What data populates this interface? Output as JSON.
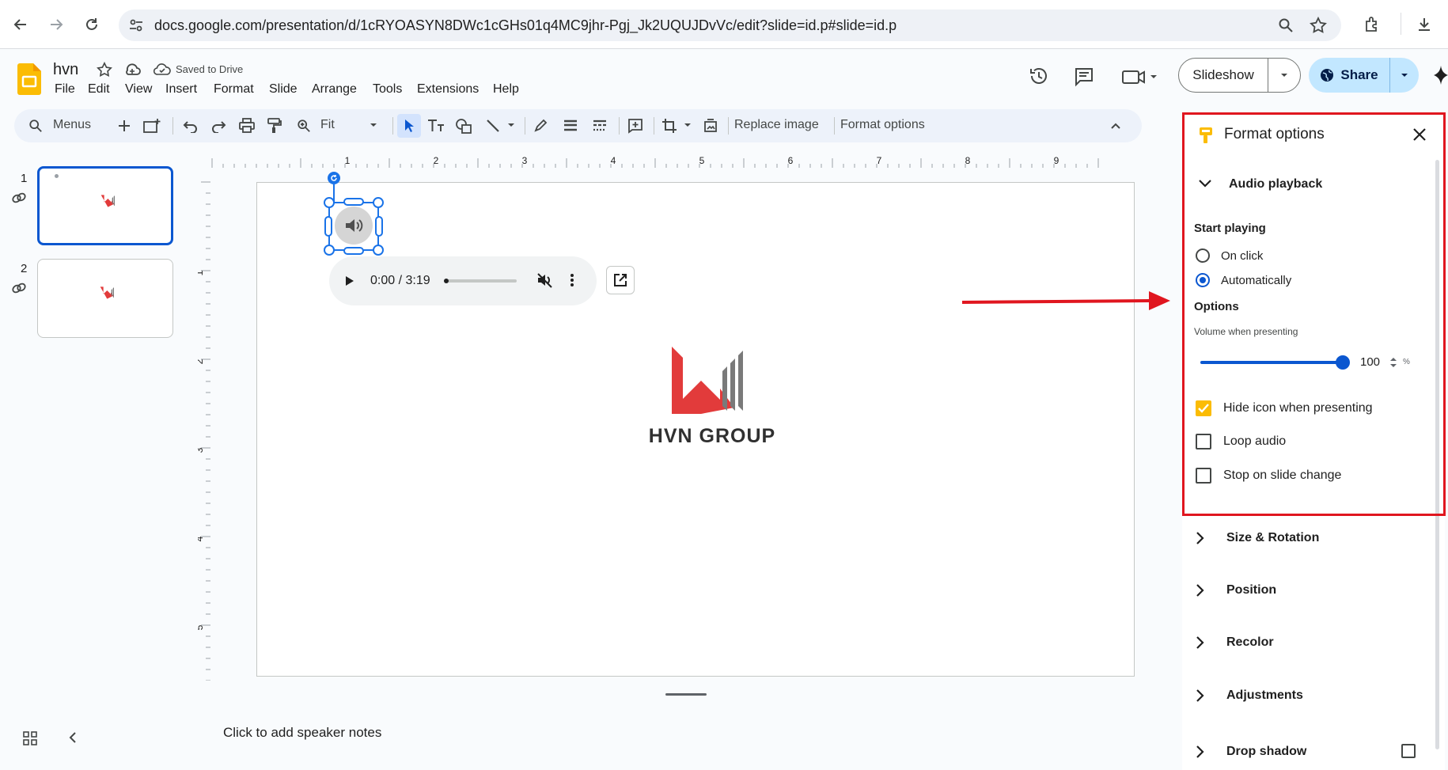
{
  "browser": {
    "url": "docs.google.com/presentation/d/1cRYOASYN8DWc1cGHs01q4MC9jhr-Pgj_Jk2UQUJDvVc/edit?slide=id.p#slide=id.p"
  },
  "app": {
    "doc_title": "hvn",
    "save_status": "Saved to Drive",
    "menus": [
      "File",
      "Edit",
      "View",
      "Insert",
      "Format",
      "Slide",
      "Arrange",
      "Tools",
      "Extensions",
      "Help"
    ],
    "slideshow_label": "Slideshow",
    "share_label": "Share"
  },
  "toolbar": {
    "menus_label": "Menus",
    "zoom_label": "Fit",
    "replace_image_label": "Replace image",
    "format_options_label": "Format options"
  },
  "filmstrip": {
    "slides": [
      {
        "number": "1"
      },
      {
        "number": "2"
      }
    ]
  },
  "ruler": {
    "top": [
      "1",
      "2",
      "3",
      "4",
      "5",
      "6",
      "7",
      "8",
      "9"
    ],
    "left": [
      "1",
      "2",
      "3",
      "4",
      "5"
    ]
  },
  "slide": {
    "logo_text": "HVN GROUP",
    "audio_time": "0:00 / 3:19",
    "audio_progress": 0.0
  },
  "notes": {
    "placeholder": "Click to add speaker notes"
  },
  "panel": {
    "title": "Format options",
    "audio_section": "Audio playback",
    "start_playing_label": "Start playing",
    "on_click_label": "On click",
    "automatically_label": "Automatically",
    "start_playing_selected": "Automatically",
    "options_label": "Options",
    "volume_label": "Volume when presenting",
    "volume_value": "100",
    "volume_unit": "%",
    "volume_level": 1.0,
    "hide_icon_label": "Hide icon when presenting",
    "hide_icon_checked": true,
    "loop_audio_label": "Loop audio",
    "loop_audio_checked": false,
    "stop_on_change_label": "Stop on slide change",
    "stop_on_change_checked": false,
    "sections": [
      "Size & Rotation",
      "Position",
      "Recolor",
      "Adjustments",
      "Drop shadow"
    ]
  },
  "colors": {
    "accent": "#0b57d0",
    "highlight": "#e0161f",
    "logo_red": "#e23b3b",
    "logo_gray": "#7a7a7a",
    "checkbox_yellow": "#fbbc04"
  }
}
